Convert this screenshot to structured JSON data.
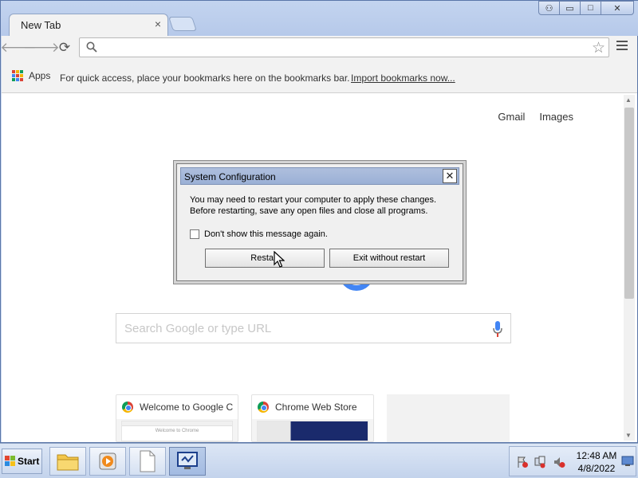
{
  "browser": {
    "tab_title": "New Tab",
    "tab_close": "×",
    "window_buttons": {
      "user": "⚇",
      "minimize": "▭",
      "maximize": "□",
      "close": "✕"
    },
    "omnibox_value": "",
    "bookmarks": {
      "apps_label": "Apps",
      "prompt": "For quick access, place your bookmarks here on the bookmarks bar.",
      "import_link": "Import bookmarks now..."
    }
  },
  "newtab": {
    "links": [
      "Gmail",
      "Images"
    ],
    "search_placeholder": "Search Google or type URL",
    "tiles": [
      {
        "title": "Welcome to Google C",
        "thumb_caption": "Welcome to Chrome"
      },
      {
        "title": "Chrome Web Store"
      }
    ]
  },
  "dialog": {
    "title": "System Configuration",
    "close": "✕",
    "message_line1": "You may need to restart your computer to apply these changes.",
    "message_line2": "Before restarting, save any open files and close all programs.",
    "checkbox_label": "Don't show this message again.",
    "checkbox_checked": false,
    "restart_button": "Restart",
    "exit_button": "Exit without restart"
  },
  "taskbar": {
    "start_label": "Start",
    "clock_time": "12:48 AM",
    "clock_date": "4/8/2022"
  },
  "colors": {
    "accent_blue": "#4285f4",
    "title_blue": "#b6c9ea"
  }
}
